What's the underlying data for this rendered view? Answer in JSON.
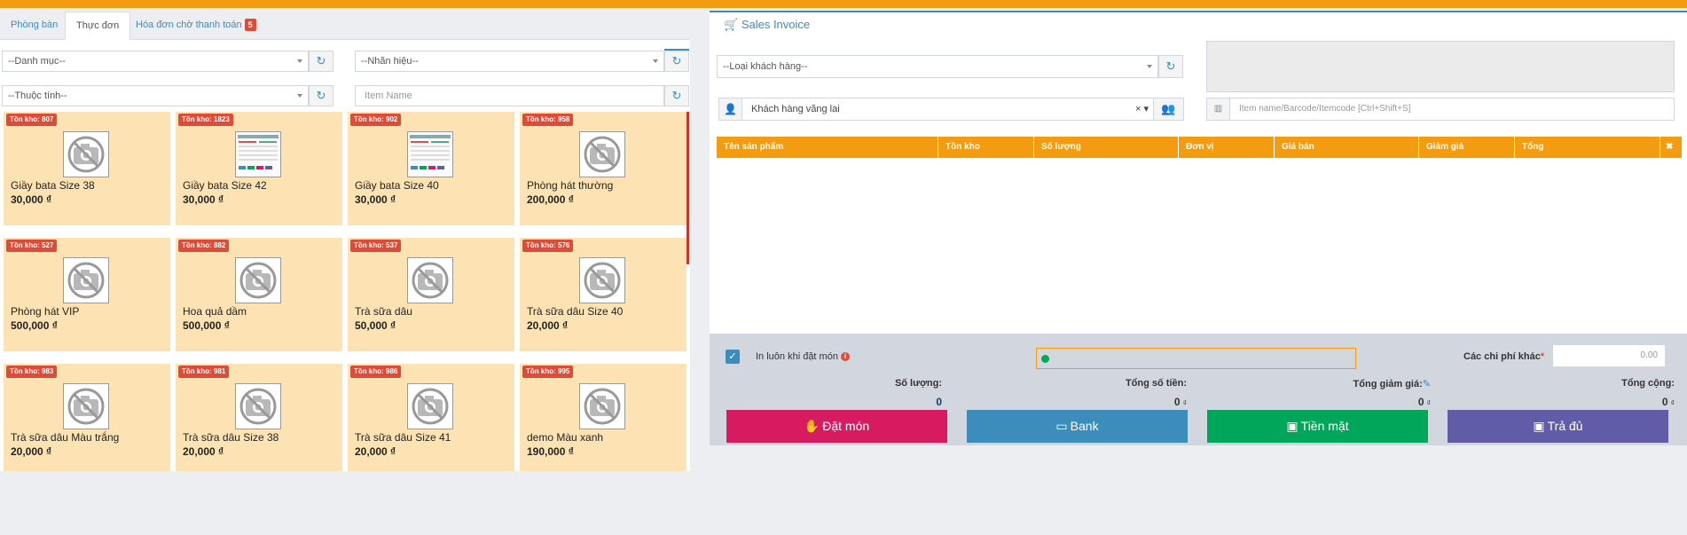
{
  "tabs": [
    {
      "label": "Phòng bàn"
    },
    {
      "label": "Thực đơn"
    },
    {
      "label": "Hóa đơn chờ thanh toán",
      "badge": "5"
    }
  ],
  "filters": {
    "category": "--Danh mục--",
    "brand": "--Nhãn hiệu--",
    "attribute": "--Thuộc tính--",
    "item_name_placeholder": "Item Name"
  },
  "products": [
    {
      "stock": "Tồn kho: 807",
      "name": "Giầy bata  Size 38",
      "price": "30,000 ₫",
      "image": "no-image-icon"
    },
    {
      "stock": "Tồn kho: 1823",
      "name": "Giầy bata  Size 42",
      "price": "30,000 ₫",
      "image": "product-screenshot-thumbnail"
    },
    {
      "stock": "Tồn kho: 902",
      "name": "Giầy bata  Size 40",
      "price": "30,000 ₫",
      "image": "product-screenshot-thumbnail"
    },
    {
      "stock": "Tồn kho: 958",
      "name": "Phòng hát thường",
      "price": "200,000 ₫",
      "image": "no-image-icon"
    },
    {
      "stock": "Tồn kho: 527",
      "name": "Phòng hát VIP",
      "price": "500,000 ₫",
      "image": "no-image-icon"
    },
    {
      "stock": "Tồn kho: 882",
      "name": "Hoa quả dầm",
      "price": "500,000 ₫",
      "image": "no-image-icon"
    },
    {
      "stock": "Tồn kho: 537",
      "name": "Trà sữa dâu",
      "price": "50,000 ₫",
      "image": "no-image-icon"
    },
    {
      "stock": "Tồn kho: 576",
      "name": "Trà sữa dâu  Size 40",
      "price": "20,000 ₫",
      "image": "no-image-icon"
    },
    {
      "stock": "Tồn kho: 983",
      "name": "Trà sữa dâu  Màu trắng",
      "price": "20,000 ₫",
      "image": "no-image-icon"
    },
    {
      "stock": "Tồn kho: 981",
      "name": "Trà sữa dâu  Size 38",
      "price": "20,000 ₫",
      "image": "no-image-icon"
    },
    {
      "stock": "Tồn kho: 986",
      "name": "Trà sữa dâu  Size 41",
      "price": "20,000 ₫",
      "image": "no-image-icon"
    },
    {
      "stock": "Tồn kho: 995",
      "name": "demo  Màu xanh",
      "price": "190,000 ₫",
      "image": "no-image-icon"
    }
  ],
  "invoice": {
    "title": "Sales Invoice",
    "customer_type": "--Loại khách hàng--",
    "customer": "Khách hàng vãng lai",
    "customer_clear": "×",
    "search_placeholder": "Item name/Barcode/Itemcode [Ctrl+Shift+S]",
    "columns": [
      "Tên sản phẩm",
      "Tồn kho",
      "Số lượng",
      "Đơn vị",
      "Giá bán",
      "Giảm giá",
      "Tổng"
    ],
    "delete_all": "✖",
    "print_label": "In luôn khi đặt món",
    "info": "i",
    "other_fees_label": "Các chi phí khác",
    "required_mark": "*",
    "other_fees_value": "0.00",
    "summary": {
      "qty_label": "Số lượng:",
      "qty_value": "0",
      "total_label": "Tổng số tiền:",
      "total_value": "0",
      "discount_label": "Tổng giảm giá:",
      "discount_value": "0",
      "grand_label": "Tổng cộng:",
      "grand_value": "0",
      "currency": "₫"
    },
    "buttons": {
      "order": "Đặt món",
      "bank": "Bank",
      "cash": "Tiền mặt",
      "full": "Trả đủ"
    }
  },
  "colors": {
    "accent": "#f39c12",
    "primary": "#3c8dbc",
    "order": "#d81b60",
    "bank": "#3c8dbc",
    "cash": "#00a65a",
    "full": "#605ca8",
    "card": "#fde3b4",
    "badge": "#dd4b39"
  }
}
